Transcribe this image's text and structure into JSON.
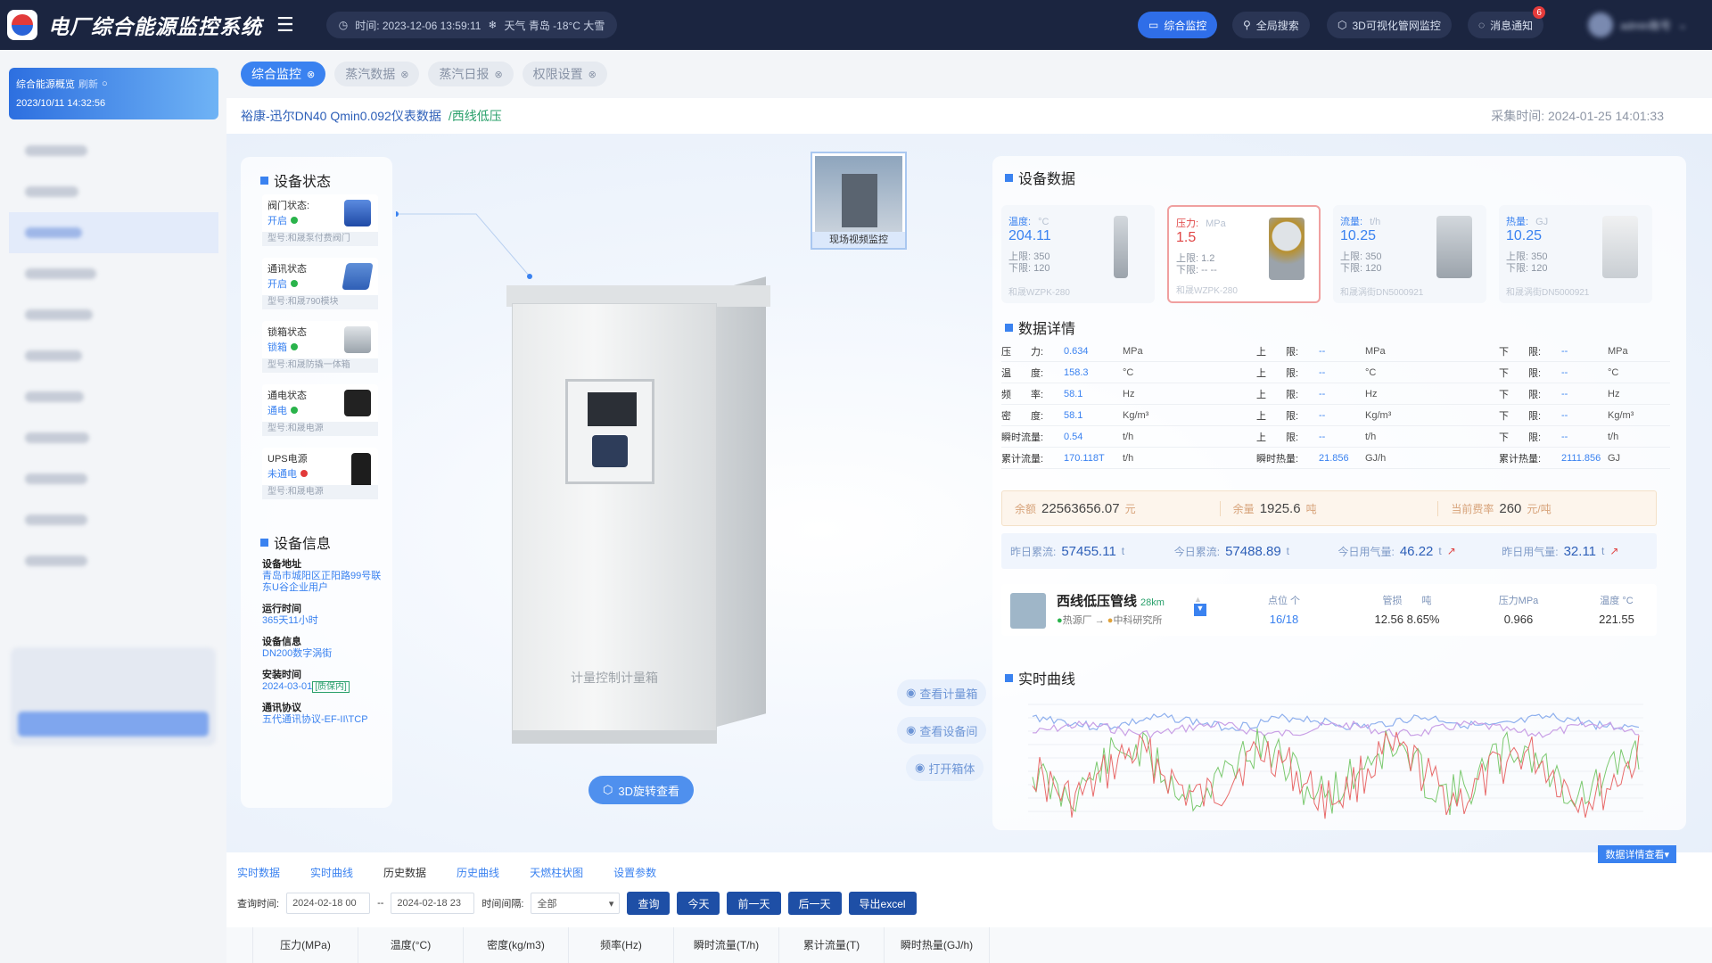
{
  "header": {
    "title": "电厂综合能源监控系统",
    "time_label": "时间: 2023-12-06  13:59:11",
    "weather_label": "天气  青岛  -18°C  大雪",
    "buttons": [
      {
        "label": "综合监控"
      },
      {
        "label": "全局搜索"
      },
      {
        "label": "3D可视化管网监控"
      },
      {
        "label": "消息通知"
      }
    ],
    "notify_count": "6",
    "user_name": "admin账号"
  },
  "sidebar": {
    "card_title": "综合能源概览",
    "card_refresh": "刷新",
    "card_time": "2023/10/11  14:32:56"
  },
  "tabs": [
    {
      "label": "综合监控"
    },
    {
      "label": "蒸汽数据"
    },
    {
      "label": "蒸汽日报"
    },
    {
      "label": "权限设置"
    }
  ],
  "titlebar": {
    "title": "裕康-迅尔DN40 Qmin0.092仪表数据",
    "subtitle": "/西线低压",
    "collect_time": "采集时间:   2024-01-25 14:01:33"
  },
  "device_status": {
    "title": "设备状态",
    "items": [
      {
        "label": "阀门状态:",
        "value": "开启",
        "model": "型号:和晟泵付费阀门",
        "status_color": "#2ab34b"
      },
      {
        "label": "通讯状态",
        "value": "开启",
        "model": "型号:和晟790模块",
        "status_color": "#2ab34b"
      },
      {
        "label": "锁箱状态",
        "value": "锁箱",
        "model": "型号:和晟防撬一体箱",
        "status_color": "#2ab34b"
      },
      {
        "label": "通电状态",
        "value": "通电",
        "model": "型号:和晟电源",
        "status_color": "#2ab34b"
      },
      {
        "label": "UPS电源",
        "value": "未通电",
        "model": "型号:和晟电源",
        "status_color": "#e23a3a"
      }
    ]
  },
  "device_info": {
    "title": "设备信息",
    "address_label": "设备地址",
    "address_value": "青岛市城阳区正阳路99号联东U谷企业用户",
    "runtime_label": "运行时间",
    "runtime_value": "365天11小时",
    "info_label": "设备信息",
    "info_value": "DN200数字涡街",
    "install_label": "安装时间",
    "install_value": "2024-03-01",
    "install_tag": "[质保内]",
    "protocol_label": "通讯协议",
    "protocol_value": "五代通讯协议-EF-II\\TCP"
  },
  "cabinet": {
    "text": "计量控制计量箱",
    "video_label": "现场视频监控"
  },
  "actions": {
    "view_meter": "查看计量箱",
    "view_device": "查看设备间",
    "open_box": "打开箱体",
    "rotate": "3D旋转查看"
  },
  "device_data": {
    "title": "设备数据",
    "cards": [
      {
        "label": "温度:",
        "unit": "°C",
        "value": "204.11",
        "upper": "上限:  350",
        "lower": "下限:  120",
        "model": "和晟WZPK-280"
      },
      {
        "label": "压力:",
        "unit": "MPa",
        "value": "1.5",
        "upper": "上限:  1.2",
        "lower": "下限:  -- --",
        "model": "和晟WZPK-280"
      },
      {
        "label": "流量:",
        "unit": "t/h",
        "value": "10.25",
        "upper": "上限:  350",
        "lower": "下限:  120",
        "model": "和晟涡街DN5000921"
      },
      {
        "label": "热量:",
        "unit": "GJ",
        "value": "10.25",
        "upper": "上限:  350",
        "lower": "下限:  120",
        "model": "和晟涡街DN5000921"
      }
    ]
  },
  "data_detail": {
    "title": "数据详情",
    "rows": [
      {
        "name": "压　　力:",
        "value": "0.634",
        "unit": "MPa",
        "ul": "上　　限:",
        "uv": "--",
        "uu": "MPa",
        "ll": "下　　限:",
        "lv": "--",
        "lu": "MPa"
      },
      {
        "name": "温　　度:",
        "value": "158.3",
        "unit": "°C",
        "ul": "上　　限:",
        "uv": "--",
        "uu": "°C",
        "ll": "下　　限:",
        "lv": "--",
        "lu": "°C"
      },
      {
        "name": "频　　率:",
        "value": "58.1",
        "unit": "Hz",
        "ul": "上　　限:",
        "uv": "--",
        "uu": "Hz",
        "ll": "下　　限:",
        "lv": "--",
        "lu": "Hz"
      },
      {
        "name": "密　　度:",
        "value": "58.1",
        "unit": "Kg/m³",
        "ul": "上　　限:",
        "uv": "--",
        "uu": "Kg/m³",
        "ll": "下　　限:",
        "lv": "--",
        "lu": "Kg/m³"
      },
      {
        "name": "瞬时流量:",
        "value": "0.54",
        "unit": "t/h",
        "ul": "上　　限:",
        "uv": "--",
        "uu": "t/h",
        "ll": "下　　限:",
        "lv": "--",
        "lu": "t/h"
      },
      {
        "name": "累计流量:",
        "value": "170.118T",
        "unit": "t/h",
        "ul": "瞬时热量:",
        "uv": "21.856",
        "uu": "GJ/h",
        "ll": "累计热量:",
        "lv": "2111.856",
        "lu": "GJ"
      }
    ]
  },
  "balance": {
    "balance_label": "余额",
    "balance_value": "22563656.07",
    "balance_unit": "元",
    "remain_label": "余量",
    "remain_value": "1925.6",
    "remain_unit": "吨",
    "rate_label": "当前费率",
    "rate_value": "260",
    "rate_unit": "元/吨"
  },
  "usage": {
    "y_total_label": "昨日累流:",
    "y_total_value": "57455.11",
    "y_total_unit": "t",
    "t_total_label": "今日累流:",
    "t_total_value": "57488.89",
    "t_total_unit": "t",
    "t_use_label": "今日用气量:",
    "t_use_value": "46.22",
    "t_use_unit": "t",
    "y_use_label": "昨日用气量:",
    "y_use_value": "32.11",
    "y_use_unit": "t"
  },
  "pipeline": {
    "name": "西线低压管线",
    "length": "28km",
    "from": "热源厂",
    "to": "中科研究所",
    "cols": [
      {
        "label": "点位 个",
        "value": "16/18"
      },
      {
        "label": "管损　　吨",
        "value": "12.56   8.65%"
      },
      {
        "label": "压力MPa",
        "value": "0.966"
      },
      {
        "label": "温度 °C",
        "value": "221.55"
      }
    ]
  },
  "realtime": {
    "title": "实时曲线",
    "series_colors": {
      "red": "#e86a6a",
      "green": "#7bc96f",
      "blue": "#8fb0ee",
      "purple": "#c9a0e6"
    }
  },
  "bottom": {
    "tabs": [
      "实时数据",
      "实时曲线",
      "历史数据",
      "历史曲线",
      "天燃柱状图",
      "设置参数"
    ],
    "detail_button": "数据详情查看",
    "query_label": "查询时间:",
    "start": "2024-02-18 00",
    "sep": "--",
    "end": "2024-02-18 23",
    "interval_label": "时间间隔:",
    "interval_value": "全部",
    "btn_query": "查询",
    "btn_today": "今天",
    "btn_prev": "前一天",
    "btn_next": "后一天",
    "btn_export": "导出excel",
    "columns": [
      "压力(MPa)",
      "温度(°C)",
      "密度(kg/m3)",
      "频率(Hz)",
      "瞬时流量(T/h)",
      "累计流量(T)",
      "瞬时热量(GJ/h)"
    ]
  }
}
